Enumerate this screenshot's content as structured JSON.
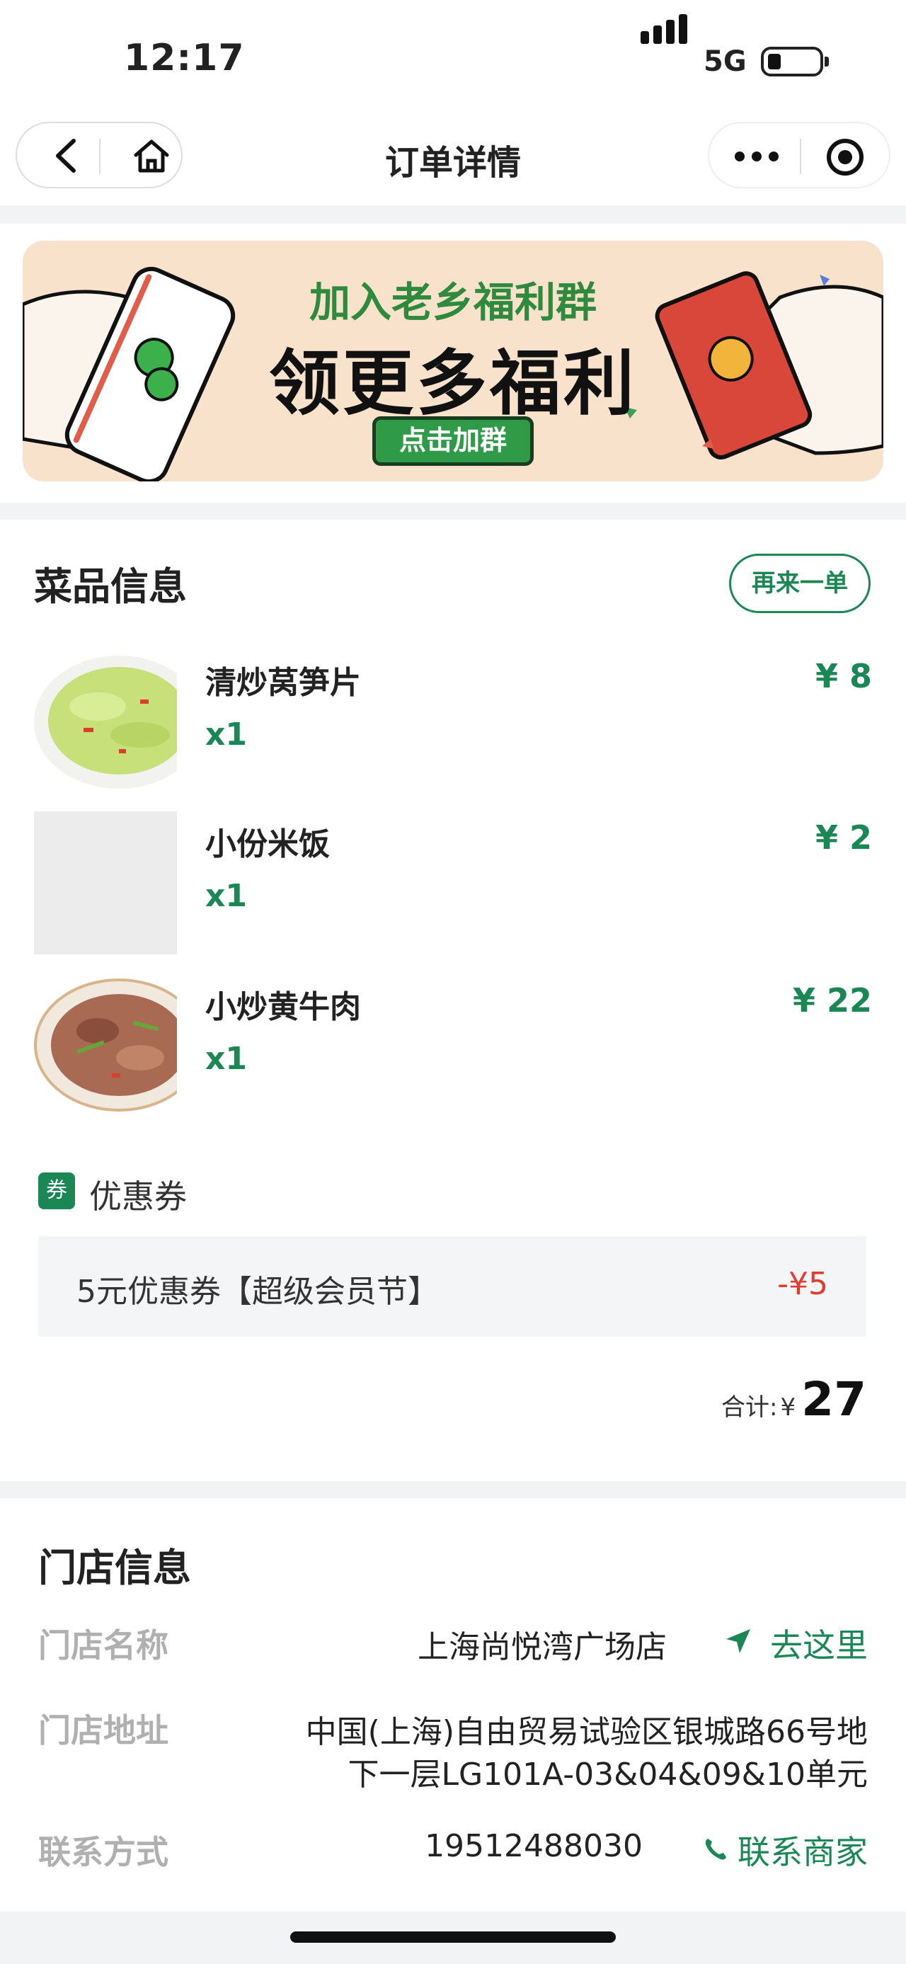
{
  "status_bar": {
    "time": "12:17",
    "network": "5G"
  },
  "nav": {
    "title": "订单详情"
  },
  "banner": {
    "line1": "加入老乡福利群",
    "line2": "领更多福利",
    "cta": "点击加群"
  },
  "dishes": {
    "title": "菜品信息",
    "reorder_label": "再来一单",
    "items": [
      {
        "name": "清炒莴笋片",
        "qty": "x1",
        "price": "¥ 8"
      },
      {
        "name": "小份米饭",
        "qty": "x1",
        "price": "¥ 2"
      },
      {
        "name": "小炒黄牛肉",
        "qty": "x1",
        "price": "¥ 22"
      }
    ]
  },
  "coupon": {
    "badge": "券",
    "label": "优惠券",
    "name": "5元优惠券【超级会员节】",
    "amount": "-¥5"
  },
  "total": {
    "label": "合计:",
    "currency": "¥",
    "amount": "27"
  },
  "store": {
    "title": "门店信息",
    "name_label": "门店名称",
    "name": "上海尚悦湾广场店",
    "navigate": "去这里",
    "address_label": "门店地址",
    "address_line1": "中国(上海)自由贸易试验区银城路66号地",
    "address_line2": "下一层LG101A-03&04&09&10单元",
    "contact_label": "联系方式",
    "phone": "19512488030",
    "contact_action": "联系商家"
  },
  "colors": {
    "accent": "#1a8754",
    "discount": "#e03c31",
    "separator": "#f1f3f5"
  }
}
